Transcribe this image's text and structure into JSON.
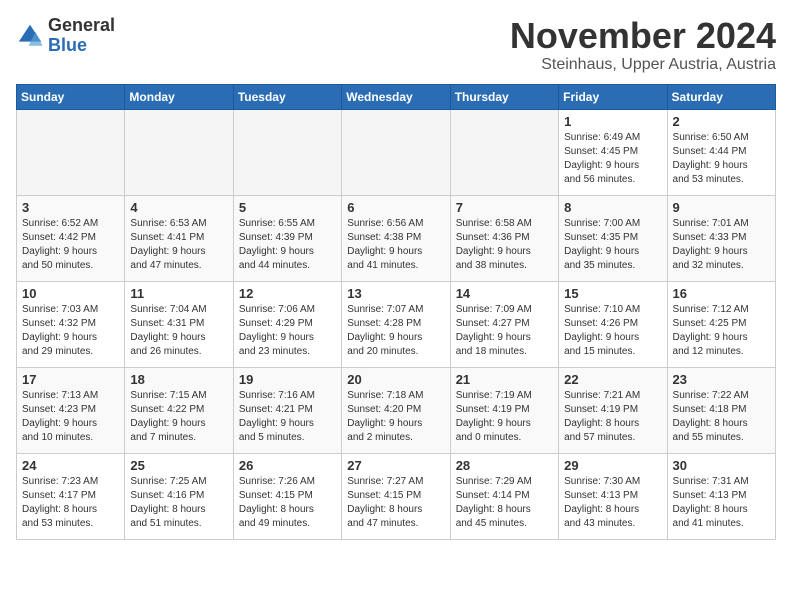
{
  "header": {
    "logo_line1": "General",
    "logo_line2": "Blue",
    "month": "November 2024",
    "location": "Steinhaus, Upper Austria, Austria"
  },
  "weekdays": [
    "Sunday",
    "Monday",
    "Tuesday",
    "Wednesday",
    "Thursday",
    "Friday",
    "Saturday"
  ],
  "weeks": [
    [
      {
        "day": "",
        "info": ""
      },
      {
        "day": "",
        "info": ""
      },
      {
        "day": "",
        "info": ""
      },
      {
        "day": "",
        "info": ""
      },
      {
        "day": "",
        "info": ""
      },
      {
        "day": "1",
        "info": "Sunrise: 6:49 AM\nSunset: 4:45 PM\nDaylight: 9 hours\nand 56 minutes."
      },
      {
        "day": "2",
        "info": "Sunrise: 6:50 AM\nSunset: 4:44 PM\nDaylight: 9 hours\nand 53 minutes."
      }
    ],
    [
      {
        "day": "3",
        "info": "Sunrise: 6:52 AM\nSunset: 4:42 PM\nDaylight: 9 hours\nand 50 minutes."
      },
      {
        "day": "4",
        "info": "Sunrise: 6:53 AM\nSunset: 4:41 PM\nDaylight: 9 hours\nand 47 minutes."
      },
      {
        "day": "5",
        "info": "Sunrise: 6:55 AM\nSunset: 4:39 PM\nDaylight: 9 hours\nand 44 minutes."
      },
      {
        "day": "6",
        "info": "Sunrise: 6:56 AM\nSunset: 4:38 PM\nDaylight: 9 hours\nand 41 minutes."
      },
      {
        "day": "7",
        "info": "Sunrise: 6:58 AM\nSunset: 4:36 PM\nDaylight: 9 hours\nand 38 minutes."
      },
      {
        "day": "8",
        "info": "Sunrise: 7:00 AM\nSunset: 4:35 PM\nDaylight: 9 hours\nand 35 minutes."
      },
      {
        "day": "9",
        "info": "Sunrise: 7:01 AM\nSunset: 4:33 PM\nDaylight: 9 hours\nand 32 minutes."
      }
    ],
    [
      {
        "day": "10",
        "info": "Sunrise: 7:03 AM\nSunset: 4:32 PM\nDaylight: 9 hours\nand 29 minutes."
      },
      {
        "day": "11",
        "info": "Sunrise: 7:04 AM\nSunset: 4:31 PM\nDaylight: 9 hours\nand 26 minutes."
      },
      {
        "day": "12",
        "info": "Sunrise: 7:06 AM\nSunset: 4:29 PM\nDaylight: 9 hours\nand 23 minutes."
      },
      {
        "day": "13",
        "info": "Sunrise: 7:07 AM\nSunset: 4:28 PM\nDaylight: 9 hours\nand 20 minutes."
      },
      {
        "day": "14",
        "info": "Sunrise: 7:09 AM\nSunset: 4:27 PM\nDaylight: 9 hours\nand 18 minutes."
      },
      {
        "day": "15",
        "info": "Sunrise: 7:10 AM\nSunset: 4:26 PM\nDaylight: 9 hours\nand 15 minutes."
      },
      {
        "day": "16",
        "info": "Sunrise: 7:12 AM\nSunset: 4:25 PM\nDaylight: 9 hours\nand 12 minutes."
      }
    ],
    [
      {
        "day": "17",
        "info": "Sunrise: 7:13 AM\nSunset: 4:23 PM\nDaylight: 9 hours\nand 10 minutes."
      },
      {
        "day": "18",
        "info": "Sunrise: 7:15 AM\nSunset: 4:22 PM\nDaylight: 9 hours\nand 7 minutes."
      },
      {
        "day": "19",
        "info": "Sunrise: 7:16 AM\nSunset: 4:21 PM\nDaylight: 9 hours\nand 5 minutes."
      },
      {
        "day": "20",
        "info": "Sunrise: 7:18 AM\nSunset: 4:20 PM\nDaylight: 9 hours\nand 2 minutes."
      },
      {
        "day": "21",
        "info": "Sunrise: 7:19 AM\nSunset: 4:19 PM\nDaylight: 9 hours\nand 0 minutes."
      },
      {
        "day": "22",
        "info": "Sunrise: 7:21 AM\nSunset: 4:19 PM\nDaylight: 8 hours\nand 57 minutes."
      },
      {
        "day": "23",
        "info": "Sunrise: 7:22 AM\nSunset: 4:18 PM\nDaylight: 8 hours\nand 55 minutes."
      }
    ],
    [
      {
        "day": "24",
        "info": "Sunrise: 7:23 AM\nSunset: 4:17 PM\nDaylight: 8 hours\nand 53 minutes."
      },
      {
        "day": "25",
        "info": "Sunrise: 7:25 AM\nSunset: 4:16 PM\nDaylight: 8 hours\nand 51 minutes."
      },
      {
        "day": "26",
        "info": "Sunrise: 7:26 AM\nSunset: 4:15 PM\nDaylight: 8 hours\nand 49 minutes."
      },
      {
        "day": "27",
        "info": "Sunrise: 7:27 AM\nSunset: 4:15 PM\nDaylight: 8 hours\nand 47 minutes."
      },
      {
        "day": "28",
        "info": "Sunrise: 7:29 AM\nSunset: 4:14 PM\nDaylight: 8 hours\nand 45 minutes."
      },
      {
        "day": "29",
        "info": "Sunrise: 7:30 AM\nSunset: 4:13 PM\nDaylight: 8 hours\nand 43 minutes."
      },
      {
        "day": "30",
        "info": "Sunrise: 7:31 AM\nSunset: 4:13 PM\nDaylight: 8 hours\nand 41 minutes."
      }
    ]
  ]
}
